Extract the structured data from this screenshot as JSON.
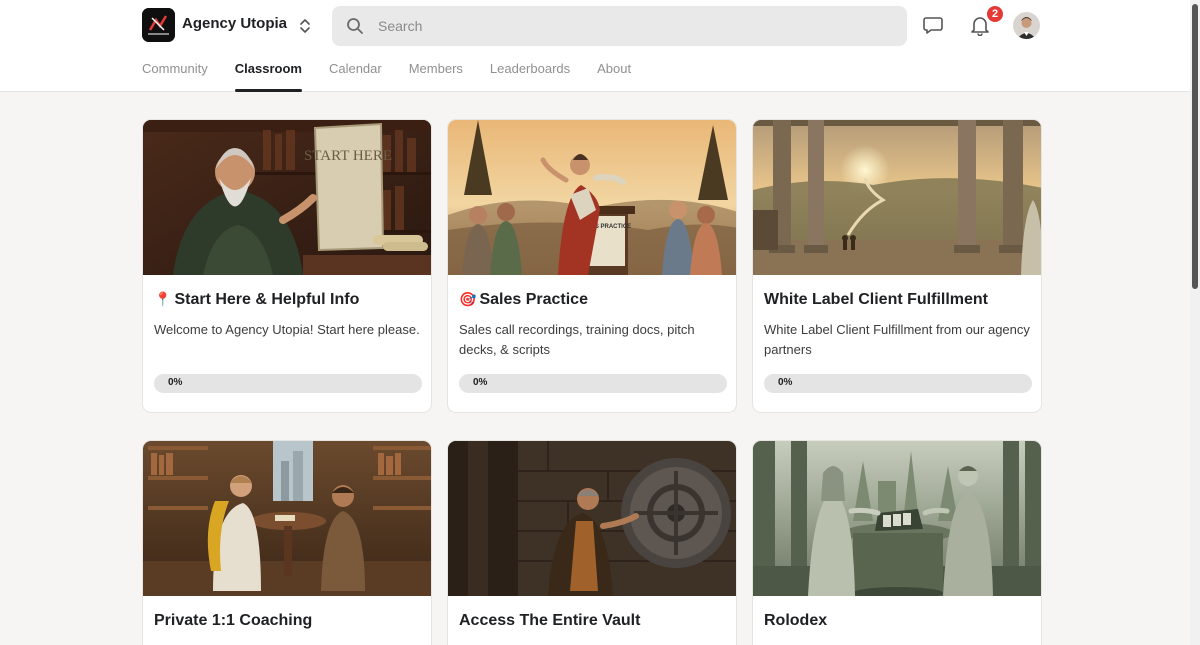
{
  "brand": {
    "name": "Agency Utopia"
  },
  "search": {
    "placeholder": "Search"
  },
  "notifications": {
    "count": "2"
  },
  "tabs": [
    {
      "label": "Community"
    },
    {
      "label": "Classroom"
    },
    {
      "label": "Calendar"
    },
    {
      "label": "Members"
    },
    {
      "label": "Leaderboards"
    },
    {
      "label": "About"
    }
  ],
  "active_tab": "Classroom",
  "courses": [
    {
      "emoji": "📍",
      "title": "Start Here & Helpful Info",
      "description": "Welcome to Agency Utopia! Start here please.",
      "progress_label": "0%",
      "progress": 0
    },
    {
      "emoji": "🎯",
      "title": "Sales Practice",
      "description": "Sales call recordings, training docs, pitch decks, & scripts",
      "progress_label": "0%",
      "progress": 0
    },
    {
      "emoji": "",
      "title": "White Label Client Fulfillment",
      "description": "White Label Client Fulfillment from our agency partners",
      "progress_label": "0%",
      "progress": 0
    },
    {
      "emoji": "",
      "title": "Private 1:1 Coaching"
    },
    {
      "emoji": "",
      "title": "Access The Entire Vault"
    },
    {
      "emoji": "",
      "title": "Rolodex"
    }
  ],
  "images": {
    "start_here_tablet_text": "START HERE",
    "sales_podium_text": "SALES PRACTICE"
  },
  "colors": {
    "accent": "#202124",
    "badge": "#e53935"
  }
}
